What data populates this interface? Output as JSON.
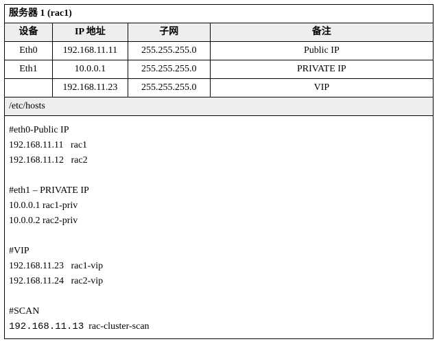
{
  "title": "服务器 1 (rac1)",
  "headers": {
    "device": "设备",
    "ip": "IP 地址",
    "subnet": "子网",
    "note": "备注"
  },
  "rows": [
    {
      "device": "Eth0",
      "ip": "192.168.11.11",
      "subnet": "255.255.255.0",
      "note": "Public IP"
    },
    {
      "device": "Eth1",
      "ip": "10.0.0.1",
      "subnet": "255.255.255.0",
      "note": "PRIVATE IP"
    },
    {
      "device": "",
      "ip": "192.168.11.23",
      "subnet": "255.255.255.0",
      "note": "VIP"
    }
  ],
  "etc_label": "/etc/hosts",
  "hosts": {
    "section_public": "#eth0-Public IP",
    "pub1": "192.168.11.11   rac1",
    "pub2": "192.168.11.12   rac2",
    "section_private": "#eth1 – PRIVATE IP",
    "priv1": "10.0.0.1 rac1-priv",
    "priv2": "10.0.0.2 rac2-priv",
    "section_vip": "#VIP",
    "vip1": "192.168.11.23   rac1-vip",
    "vip2": "192.168.11.24   rac2-vip",
    "section_scan": "#SCAN",
    "scan1_ip": "192.168.11.13",
    "scan1_host": "  rac-cluster-scan"
  }
}
